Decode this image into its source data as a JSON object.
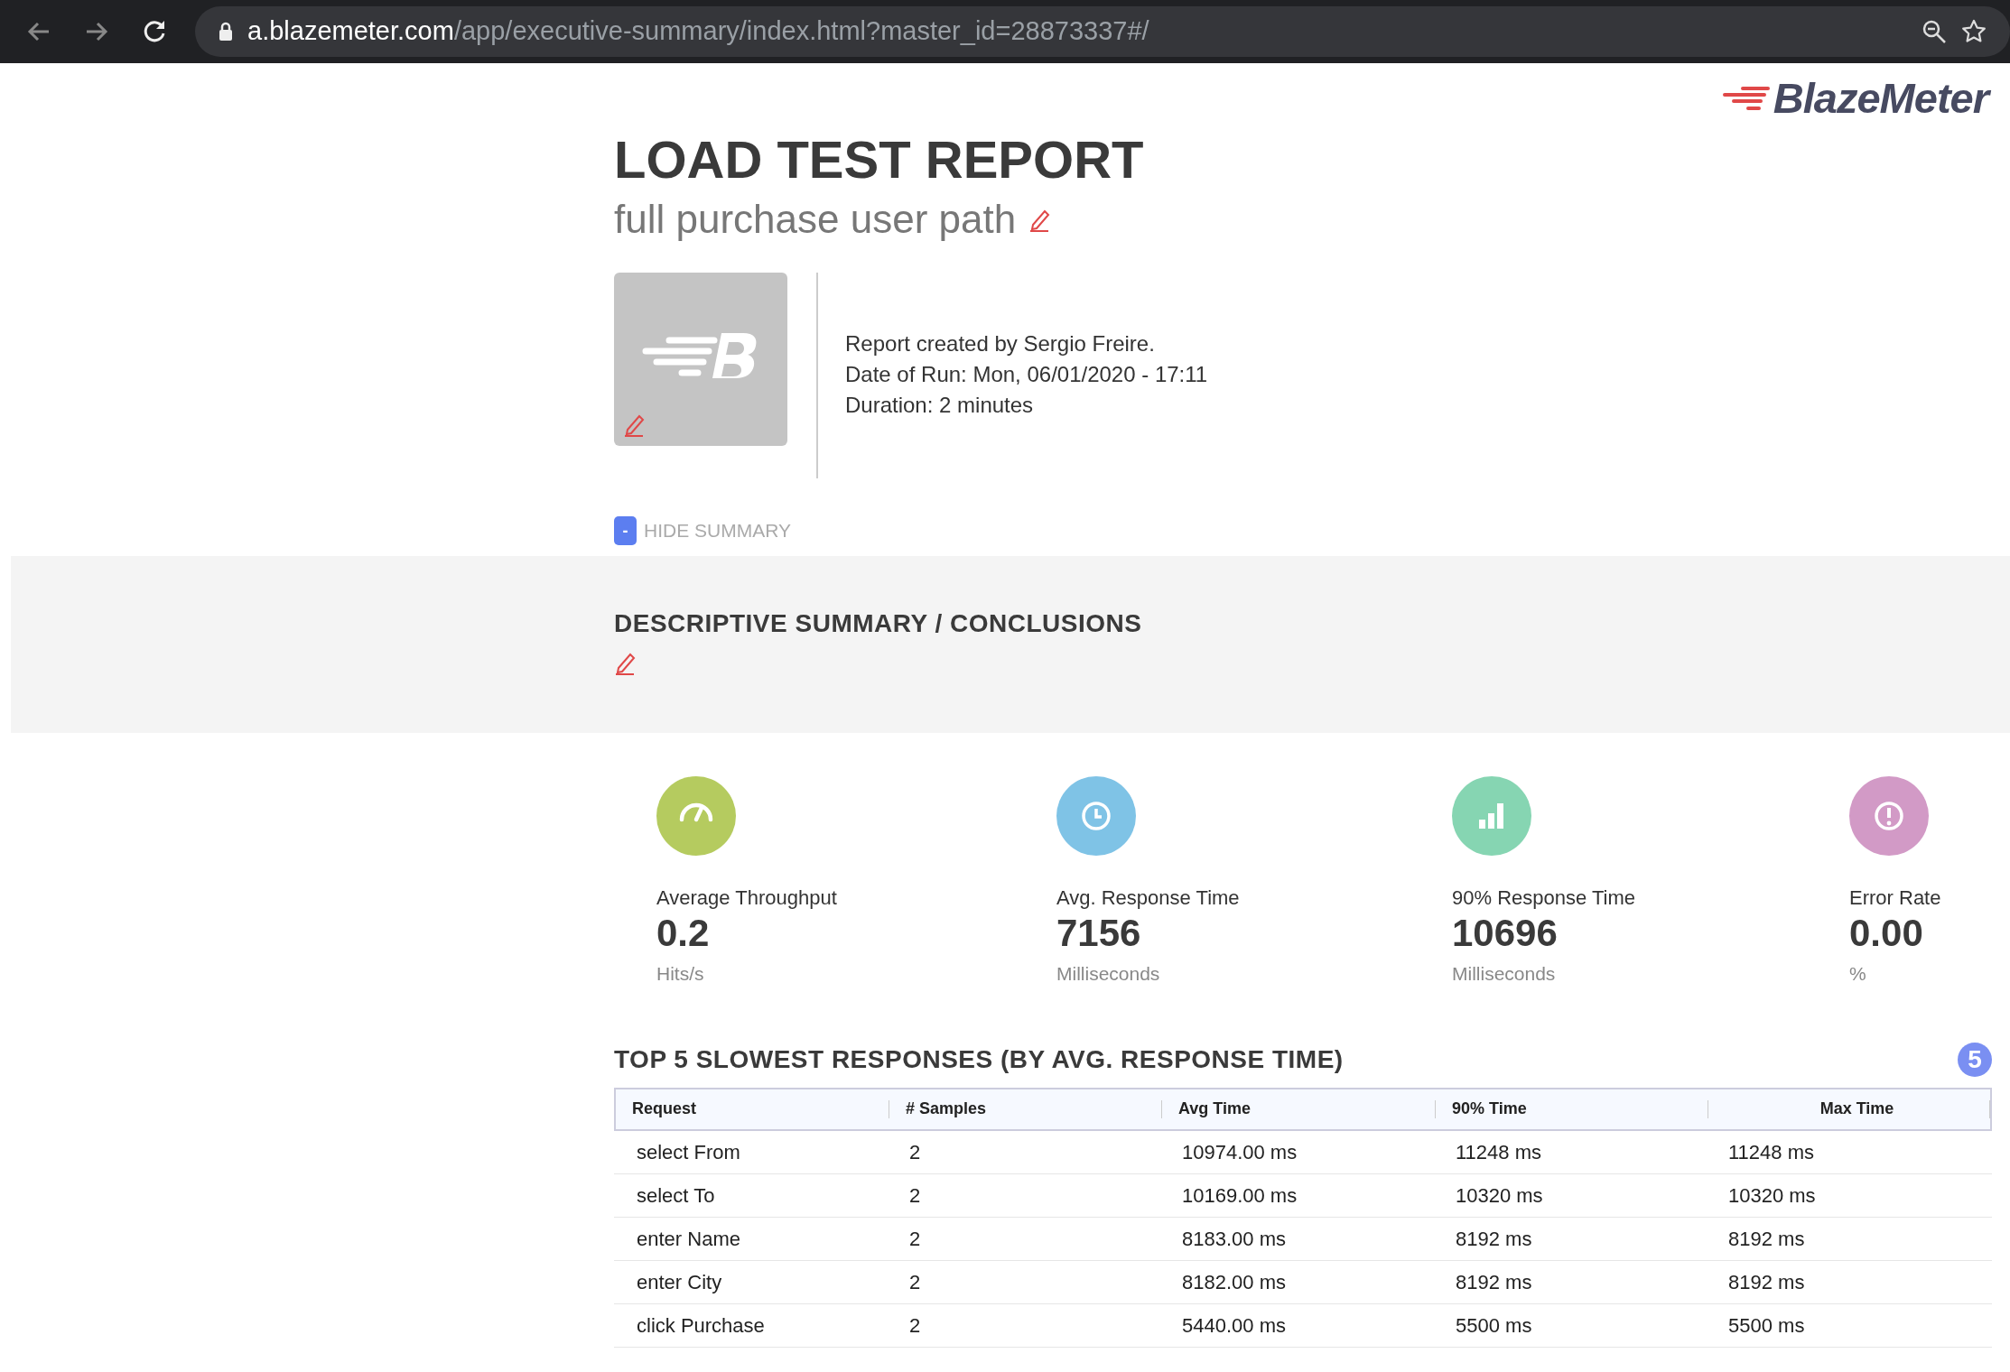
{
  "browser": {
    "url_host": "a.blazemeter.com",
    "url_path": "/app/executive-summary/index.html?master_id=28873337#/"
  },
  "brand": {
    "name": "BlazeMeter"
  },
  "report": {
    "title": "LOAD TEST REPORT",
    "subtitle": "full purchase user path",
    "meta": [
      "Report created by Sergio Freire.",
      "Date of Run: Mon, 06/01/2020 - 17:11",
      "Duration: 2 minutes"
    ]
  },
  "summary_toggle": {
    "symbol": "-",
    "label": "HIDE SUMMARY"
  },
  "summary": {
    "heading": "DESCRIPTIVE SUMMARY / CONCLUSIONS"
  },
  "stats": [
    {
      "kind": "gauge",
      "color": "#b5cb5f",
      "label": "Average Throughput",
      "value": "0.2",
      "unit": "Hits/s"
    },
    {
      "kind": "clock",
      "color": "#7fc3e6",
      "label": "Avg. Response Time",
      "value": "7156",
      "unit": "Milliseconds"
    },
    {
      "kind": "bars",
      "color": "#86d5b2",
      "label": "90% Response Time",
      "value": "10696",
      "unit": "Milliseconds"
    },
    {
      "kind": "alert",
      "color": "#d29ac6",
      "label": "Error Rate",
      "value": "0.00",
      "unit": "%"
    }
  ],
  "table": {
    "title": "TOP 5 SLOWEST RESPONSES (BY AVG. RESPONSE TIME)",
    "count": "5",
    "columns": [
      "Request",
      "# Samples",
      "Avg Time",
      "90% Time",
      "Max Time"
    ],
    "rows": [
      [
        "select From",
        "2",
        "10974.00 ms",
        "11248 ms",
        "11248 ms"
      ],
      [
        "select To",
        "2",
        "10169.00 ms",
        "10320 ms",
        "10320 ms"
      ],
      [
        "enter Name",
        "2",
        "8183.00 ms",
        "8192 ms",
        "8192 ms"
      ],
      [
        "enter City",
        "2",
        "8182.00 ms",
        "8192 ms",
        "8192 ms"
      ],
      [
        "click Purchase",
        "2",
        "5440.00 ms",
        "5500 ms",
        "5500 ms"
      ]
    ]
  }
}
